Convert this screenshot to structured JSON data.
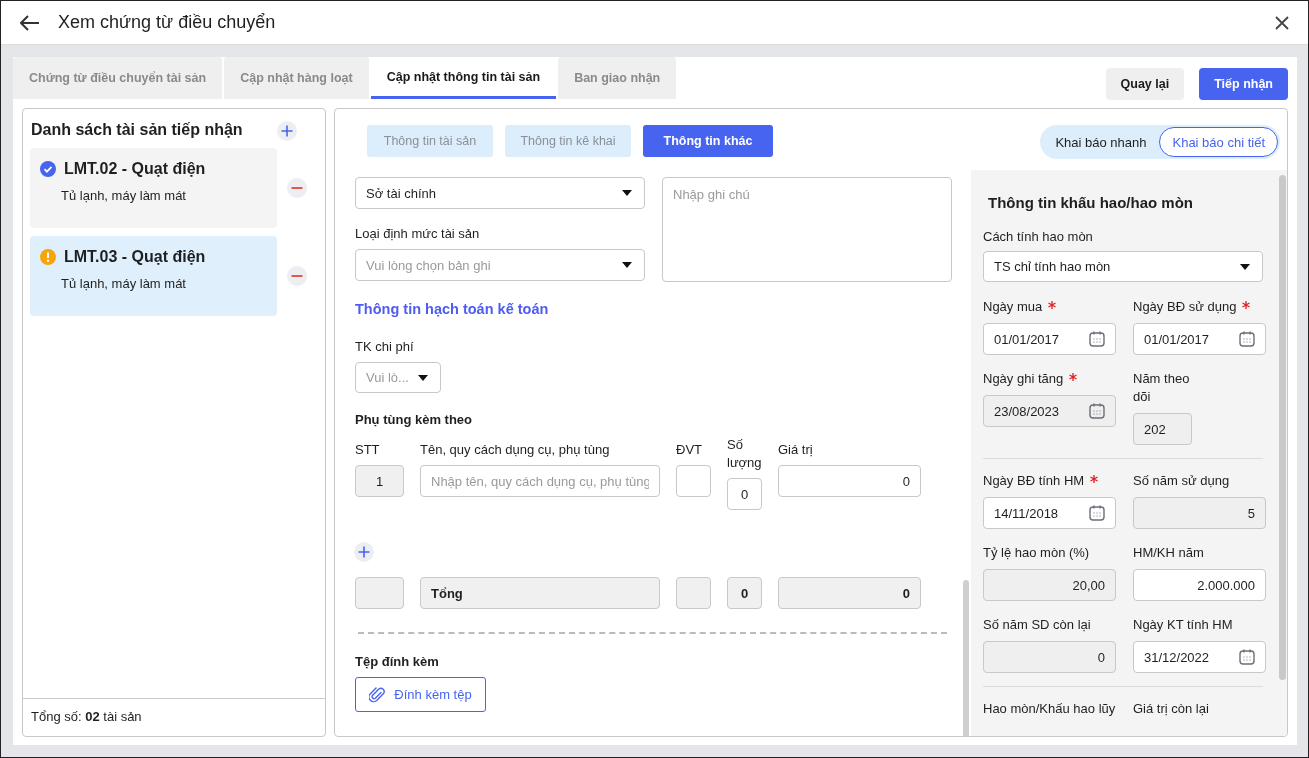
{
  "window": {
    "title": "Xem chứng từ điều chuyển"
  },
  "tabs": [
    {
      "label": "Chứng từ điều chuyển tài sản",
      "selected": false
    },
    {
      "label": "Cập nhật hàng loạt",
      "selected": false
    },
    {
      "label": "Cập nhật thông tin tài sản",
      "selected": true
    },
    {
      "label": "Ban giao nhận",
      "selected": false
    }
  ],
  "actions": [
    {
      "label": "Quay lại",
      "kind": "secondary"
    },
    {
      "label": "Tiếp nhận",
      "kind": "primary"
    }
  ],
  "asset_list": {
    "title": "Danh sách tài sản tiếp nhận",
    "items": [
      {
        "name": "LMT.02 - Quạt điện",
        "category": "Tủ lạnh, máy làm mát",
        "kind": "done",
        "selected": false
      },
      {
        "name": "LMT.03 - Quạt điện",
        "category": "Tủ lạnh, máy làm mát",
        "kind": "warning",
        "selected": true
      }
    ],
    "footer": "Tổng số: **02** tài sản"
  },
  "subtabs": [
    {
      "label": "Thông tin tài sản",
      "selected": false
    },
    {
      "label": "Thông tin kê khai",
      "selected": false
    },
    {
      "label": "Thông tin khác",
      "selected": true
    }
  ],
  "mode_toggle": [
    {
      "label": "Khai báo nhanh",
      "selected": false
    },
    {
      "label": "Khai báo chi tiết",
      "selected": true
    }
  ],
  "form": {
    "source_select": {
      "value": "Sở tài chính"
    },
    "note": {
      "placeholder": "Nhập ghi chú"
    },
    "norm_type": {
      "label": "Loại định mức tài sản",
      "placeholder": "Vui lòng chọn bản ghi"
    },
    "accounting_heading": "Thông tin hạch toán kế toán",
    "expense_account": {
      "label": "TK chi phí",
      "placeholder": "Vui lò..."
    },
    "parts": {
      "title": "Phụ tùng kèm theo",
      "columns": [
        "STT",
        "Tên, quy cách dụng cụ, phụ tùng",
        "ĐVT",
        "Số lượng",
        "Giá trị"
      ],
      "rows": [
        {
          "stt": "1",
          "name_placeholder": "Nhập tên, quy cách dụng cụ, phụ tùng",
          "quantity": "0",
          "value": "0"
        }
      ],
      "total": {
        "label": "Tổng",
        "quantity": "0",
        "value": "0"
      }
    },
    "attachments": {
      "title": "Tệp đính kèm",
      "button": "Đính kèm tệp"
    }
  },
  "depreciation": {
    "title": "Thông tin khấu hao/hao mòn",
    "method": {
      "label": "Cách tính hao mòn",
      "value": "TS chỉ tính hao mòn"
    },
    "groups": [
      [
        {
          "label": "Ngày mua",
          "required": true,
          "kind": "date",
          "value": "01/01/2017",
          "disabled": false
        },
        {
          "label": "Ngày BĐ sử dụng",
          "required": true,
          "kind": "date",
          "value": "01/01/2017",
          "disabled": false
        },
        {
          "label": "Ngày ghi tăng",
          "required": true,
          "kind": "date",
          "value": "23/08/2023",
          "disabled": true
        },
        {
          "label": "Năm theo dõi",
          "required": false,
          "kind": "year",
          "value": "202",
          "disabled": true
        }
      ],
      [
        {
          "label": "Ngày BĐ tính HM",
          "required": true,
          "kind": "date",
          "value": "14/11/2018",
          "disabled": false
        },
        {
          "label": "Số năm sử dụng",
          "required": false,
          "kind": "number",
          "value": "5",
          "disabled": true
        },
        {
          "label": "Tỷ lệ hao mòn (%)",
          "required": false,
          "kind": "number",
          "value": "20,00",
          "disabled": true
        },
        {
          "label": "HM/KH năm",
          "required": false,
          "kind": "number",
          "value": "2.000.000",
          "disabled": false
        },
        {
          "label": "Số năm SD còn lại",
          "required": false,
          "kind": "number",
          "value": "0",
          "disabled": true
        },
        {
          "label": "Ngày KT tính HM",
          "required": false,
          "kind": "date",
          "value": "31/12/2022",
          "disabled": false
        }
      ],
      [
        {
          "label": "Hao mòn/Khấu hao lũy",
          "required": false,
          "kind": "label"
        },
        {
          "label": "Giá trị còn lại",
          "required": false,
          "kind": "label"
        }
      ]
    ]
  }
}
